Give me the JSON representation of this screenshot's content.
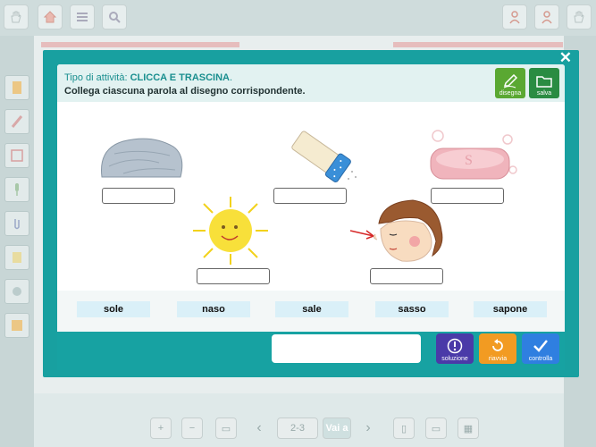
{
  "instructions": {
    "activity_prefix": "Tipo di attività: ",
    "activity_type": "CLICCA E TRASCINA",
    "activity_suffix": ".",
    "task": "Collega ciascuna parola al disegno corrispondente."
  },
  "tools": {
    "draw_label": "disegna",
    "save_label": "salva"
  },
  "drawings": [
    {
      "name": "stone",
      "icon": "stone-drawing"
    },
    {
      "name": "salt-shaker",
      "icon": "salt-shaker-drawing"
    },
    {
      "name": "soap",
      "icon": "soap-drawing"
    },
    {
      "name": "sun",
      "icon": "sun-drawing"
    },
    {
      "name": "face-nose",
      "icon": "face-nose-drawing"
    }
  ],
  "words": [
    "sole",
    "naso",
    "sale",
    "sasso",
    "sapone"
  ],
  "actions": {
    "solution_label": "soluzione",
    "restart_label": "riavvia",
    "check_label": "controlla"
  },
  "colors": {
    "teal": "#18a0a0",
    "draw_green": "#5aa832",
    "save_green": "#2a8c42",
    "solution_purple": "#4a3aa8",
    "restart_orange": "#f29b22",
    "check_blue": "#2f7fe0",
    "word_bg": "#daf0f8"
  },
  "background": {
    "pager": "2-3",
    "go_label": "Vai a"
  }
}
